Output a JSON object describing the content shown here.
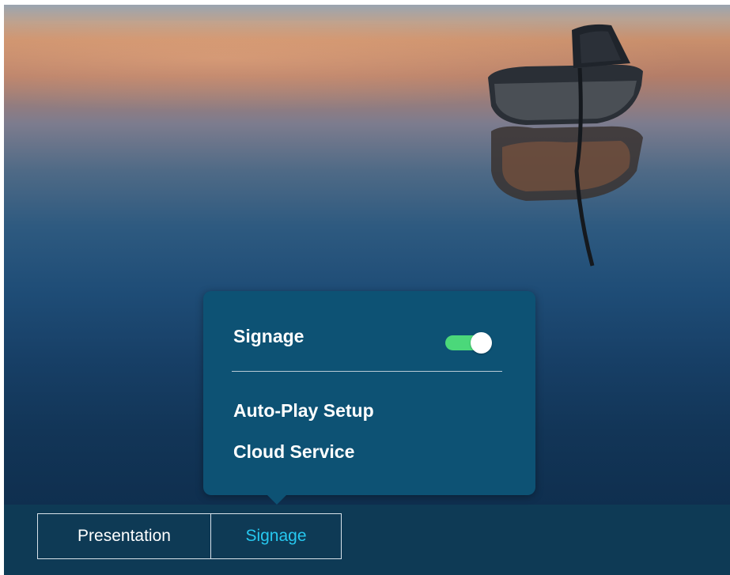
{
  "wallpaper": {
    "description_icon": "boat-on-lake-wallpaper"
  },
  "popup": {
    "title": "Signage",
    "toggle_state": "on",
    "toggle_color": "#4bd87a",
    "items": [
      {
        "label": "Auto-Play Setup"
      },
      {
        "label": "Cloud Service"
      }
    ]
  },
  "taskbar": {
    "tabs": [
      {
        "label": "Presentation",
        "active": false
      },
      {
        "label": "Signage",
        "active": true
      }
    ],
    "active_color": "#26c8f0"
  }
}
